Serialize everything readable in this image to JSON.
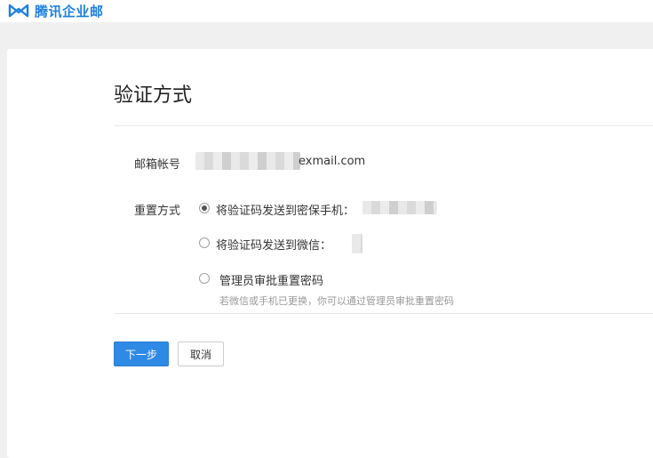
{
  "header": {
    "brand": "腾讯企业邮",
    "logo_icon": "infinity-logo-icon",
    "brand_color": "#1d7fe0"
  },
  "page": {
    "title": "验证方式"
  },
  "form": {
    "account_label": "邮箱帐号",
    "account_domain": "exmail.com",
    "reset_label": "重置方式",
    "options": [
      {
        "label": "将验证码发送到密保手机：",
        "checked": true
      },
      {
        "label": "将验证码发送到微信：",
        "checked": false
      },
      {
        "label": "管理员审批重置密码",
        "checked": false
      }
    ],
    "admin_hint": "若微信或手机已更换，你可以通过管理员审批重置密码"
  },
  "actions": {
    "next_label": "下一步",
    "cancel_label": "取消",
    "primary_color": "#2f8ae5"
  }
}
